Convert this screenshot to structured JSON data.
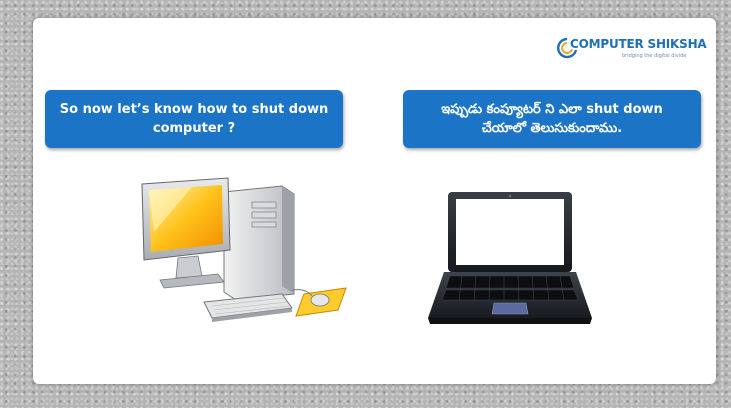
{
  "logo": {
    "brand_first": "COMPUTER",
    "brand_second": "SHIKSHA",
    "tagline": "bridging the digital divide",
    "colors": {
      "primary": "#1f6fb7",
      "accent": "#f5a623"
    }
  },
  "bubbles": {
    "english": {
      "line1": "So now let’s know how to shut down",
      "line2": "computer ?"
    },
    "telugu": {
      "line1": "ఇప్పుడు కంప్యూటర్ ని ఎలా shut down",
      "line2": "చేయాలో తెలుసుకుందాము."
    },
    "color": "#1b74c5"
  },
  "illustrations": {
    "left": "desktop-computer-icon",
    "right": "laptop-icon"
  }
}
